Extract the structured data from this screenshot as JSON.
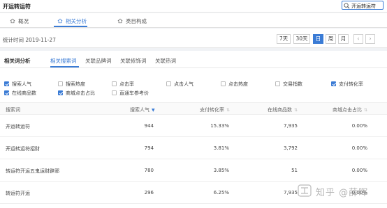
{
  "app": {
    "title": "开运转运符"
  },
  "search": {
    "value": "开运转运符",
    "icon": "search-icon"
  },
  "tabs": [
    {
      "label": "概况",
      "icon": "home-icon",
      "active": false
    },
    {
      "label": "相关分析",
      "icon": "home-icon",
      "active": true
    },
    {
      "label": "类目构成",
      "icon": "home-icon",
      "active": false
    }
  ],
  "stat": {
    "label": "统计时间 2019-11-27",
    "ranges": [
      {
        "label": "7天",
        "active": false
      },
      {
        "label": "30天",
        "active": false
      },
      {
        "label": "日",
        "active": true
      },
      {
        "label": "周",
        "active": false
      },
      {
        "label": "月",
        "active": false
      }
    ],
    "prev": "‹",
    "next": "›"
  },
  "panel": {
    "title": "相关词分析",
    "subtabs": [
      {
        "label": "相关搜索词",
        "active": true
      },
      {
        "label": "关联品牌词",
        "active": false
      },
      {
        "label": "关联修饰词",
        "active": false
      },
      {
        "label": "关联热词",
        "active": false
      }
    ]
  },
  "metrics": [
    {
      "label": "搜索人气",
      "checked": true
    },
    {
      "label": "搜索热度",
      "checked": false
    },
    {
      "label": "点击率",
      "checked": false
    },
    {
      "label": "点击人气",
      "checked": false
    },
    {
      "label": "点击热度",
      "checked": false
    },
    {
      "label": "交易指数",
      "checked": false
    },
    {
      "label": "支付转化率",
      "checked": true
    },
    {
      "label": "在线商品数",
      "checked": true
    },
    {
      "label": "商城点击占比",
      "checked": true
    },
    {
      "label": "直通车参考价",
      "checked": false
    }
  ],
  "table": {
    "columns": [
      "搜索词",
      "搜索人气",
      "支付转化率",
      "在线商品数",
      "商城点击占比"
    ],
    "sort_down": "▼",
    "sort_both": "⇅",
    "rows": [
      [
        "开运转运符",
        "944",
        "15.33%",
        "7,935",
        "0.00%"
      ],
      [
        "开运转运符招财",
        "794",
        "3.81%",
        "3,792",
        "0.00%"
      ],
      [
        "转运符开运五鬼运财辟邪",
        "780",
        "3.85%",
        "51",
        "0.00%"
      ],
      [
        "转运符开运",
        "296",
        "6.25%",
        "7,935",
        "0.00%"
      ]
    ]
  },
  "watermark": {
    "text": "知乎 @薛晖",
    "icon": "zhihu-logo-icon"
  },
  "colors": {
    "accent": "#3a7bd5",
    "background": "#f0f2f5"
  }
}
